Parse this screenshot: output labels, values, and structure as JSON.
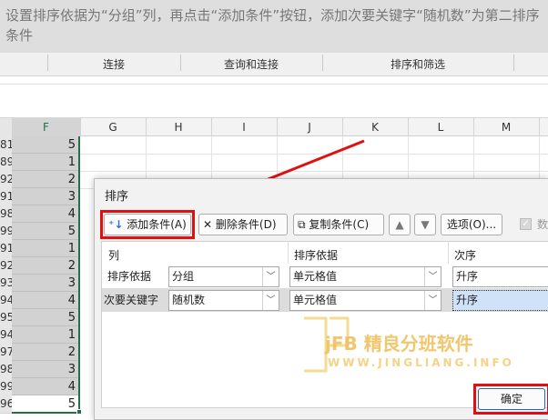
{
  "instruction": "设置排序依据为“分组”列，再点击“添加条件”按钮，添加次要关键字“随机数”为第二排序条件",
  "ribbon": {
    "groups": [
      "连接",
      "查询和连接",
      "排序和筛选"
    ]
  },
  "columns": {
    "F": "F",
    "G": "G",
    "H": "H",
    "I": "I",
    "J": "J",
    "K": "K",
    "L": "L",
    "M": "M"
  },
  "rows": [
    {
      "num": "81",
      "value": "5"
    },
    {
      "num": "89",
      "value": "1"
    },
    {
      "num": "92",
      "value": "2"
    },
    {
      "num": "91",
      "value": "3"
    },
    {
      "num": "98",
      "value": "4"
    },
    {
      "num": "99",
      "value": "5"
    },
    {
      "num": "91",
      "value": "1"
    },
    {
      "num": "92",
      "value": "2"
    },
    {
      "num": "93",
      "value": "3"
    },
    {
      "num": "94",
      "value": "4"
    },
    {
      "num": "95",
      "value": "5"
    },
    {
      "num": "94",
      "value": "1"
    },
    {
      "num": "97",
      "value": "2"
    },
    {
      "num": "98",
      "value": "3"
    },
    {
      "num": "99",
      "value": "4"
    },
    {
      "num": "96",
      "value": "5"
    }
  ],
  "dialog": {
    "title": "排序",
    "add_btn": "添加条件(A)",
    "del_btn": "删除条件(D)",
    "copy_btn": "复制条件(C)",
    "options_btn": "选项(O)...",
    "header_checkbox": "数",
    "col_header": "列",
    "basis_header": "排序依据",
    "order_header": "次序",
    "rows": [
      {
        "label": "排序依据",
        "column": "分组",
        "basis": "单元格值",
        "order": "升序"
      },
      {
        "label": "次要关键字",
        "column": "随机数",
        "basis": "单元格值",
        "order": "升序"
      }
    ],
    "ok_btn": "确定"
  },
  "watermark": {
    "brand": "jFB 精良分班软件",
    "url": "WWW.JINGLIANG.INFO"
  }
}
